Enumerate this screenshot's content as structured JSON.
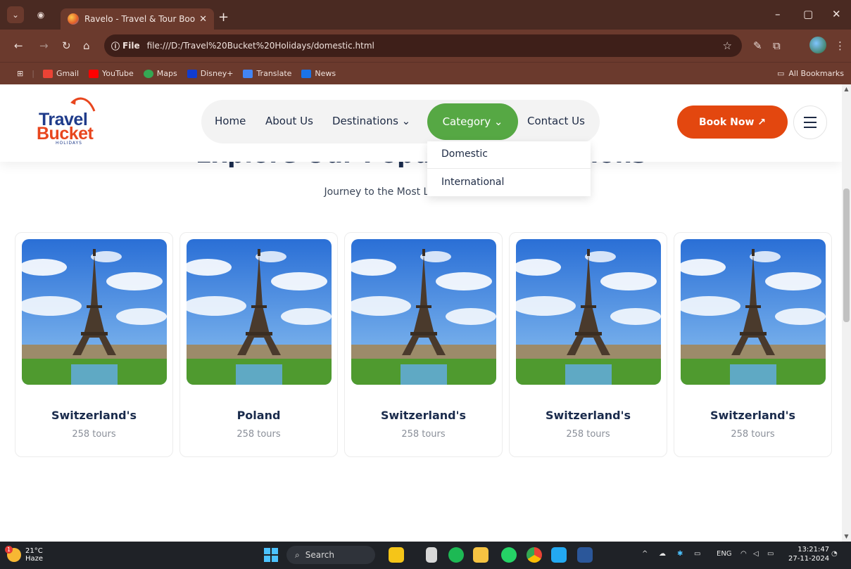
{
  "browser": {
    "tab_title": "Ravelo - Travel & Tour Booking",
    "tab_close": "✕",
    "new_tab": "+",
    "url_label": "File",
    "url": "file:///D:/Travel%20Bucket%20Holidays/domestic.html",
    "window_controls": {
      "minimize": "–",
      "restore": "▢",
      "close": "✕"
    },
    "bookmarks": [
      {
        "label": "Gmail",
        "icon": "gmail-icon",
        "color": "#ea4335"
      },
      {
        "label": "YouTube",
        "icon": "youtube-icon",
        "color": "#ff0000"
      },
      {
        "label": "Maps",
        "icon": "maps-icon",
        "color": "#34a853"
      },
      {
        "label": "Disney+",
        "icon": "disney-icon",
        "color": "#113ccf"
      },
      {
        "label": "Translate",
        "icon": "translate-icon",
        "color": "#4285f4"
      },
      {
        "label": "News",
        "icon": "news-icon",
        "color": "#1a73e8"
      }
    ],
    "all_bookmarks": "All Bookmarks"
  },
  "site": {
    "logo": {
      "line1": "Travel",
      "line2": "Bucket",
      "line3": "HOLIDAYS"
    },
    "nav": [
      {
        "label": "Home"
      },
      {
        "label": "About Us"
      },
      {
        "label": "Destinations ⌄"
      },
      {
        "label": "Category ⌄",
        "active": true
      },
      {
        "label": "Contact Us"
      }
    ],
    "dropdown": [
      "Domestic",
      "International"
    ],
    "book_now": "Book Now ↗",
    "section_title": "Explore Our Popular Destinations",
    "section_subtitle": "Journey to the Most Loved Destinations",
    "cards": [
      {
        "name": "Switzerland's",
        "tours": "258 tours"
      },
      {
        "name": "Poland",
        "tours": "258 tours"
      },
      {
        "name": "Switzerland's",
        "tours": "258 tours"
      },
      {
        "name": "Switzerland's",
        "tours": "258 tours"
      },
      {
        "name": "Switzerland's",
        "tours": "258 tours"
      }
    ]
  },
  "taskbar": {
    "weather_temp": "21°C",
    "weather_desc": "Haze",
    "weather_badge": "1",
    "search": "Search",
    "lang": "ENG",
    "time": "13:21:47",
    "date": "27-11-2024"
  },
  "colors": {
    "accent_green": "#56a844",
    "accent_orange": "#e3470f",
    "brand_blue": "#1f3b8a",
    "browser_frame": "#6b3a2d"
  }
}
